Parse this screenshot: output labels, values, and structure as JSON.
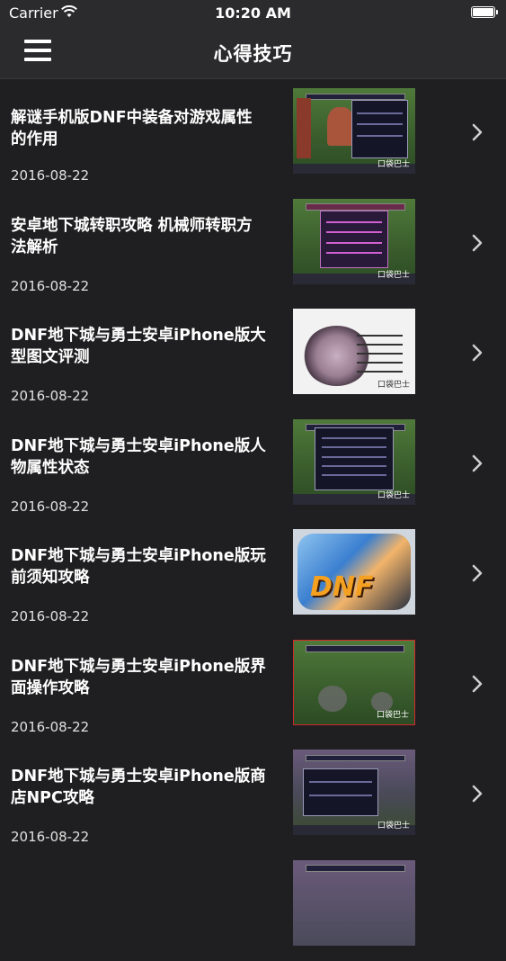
{
  "status": {
    "carrier": "Carrier",
    "time": "10:20 AM"
  },
  "nav": {
    "title": "心得技巧"
  },
  "items": [
    {
      "title": "解谜手机版DNF中装备对游戏属性的作用",
      "date": "2016-08-22"
    },
    {
      "title": "安卓地下城转职攻略 机械师转职方法解析",
      "date": "2016-08-22"
    },
    {
      "title": "DNF地下城与勇士安卓iPhone版大型图文评测",
      "date": "2016-08-22"
    },
    {
      "title": "DNF地下城与勇士安卓iPhone版人物属性状态",
      "date": "2016-08-22"
    },
    {
      "title": "DNF地下城与勇士安卓iPhone版玩前须知攻略",
      "date": "2016-08-22"
    },
    {
      "title": "DNF地下城与勇士安卓iPhone版界面操作攻略",
      "date": "2016-08-22"
    },
    {
      "title": "DNF地下城与勇士安卓iPhone版商店NPC攻略",
      "date": "2016-08-22"
    },
    {
      "title": "",
      "date": ""
    }
  ],
  "thumb_badge": "口袋巴士",
  "colors": {
    "background": "#1f1f21",
    "bar": "#2b2b2d",
    "text": "#ffffff"
  }
}
